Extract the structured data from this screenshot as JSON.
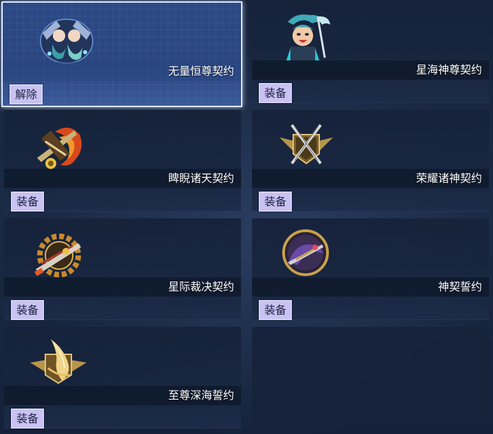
{
  "cards": [
    {
      "title": "无量恒尊契约",
      "button": "解除",
      "icon": "twin-heroes-emblem-icon"
    },
    {
      "title": "星海神尊契约",
      "button": "装备",
      "icon": "dragon-hero-portrait-icon"
    },
    {
      "title": "睥睨诸天契约",
      "button": "装备",
      "icon": "flaming-weapon-emblem-icon"
    },
    {
      "title": "荣耀诸神契约",
      "button": "装备",
      "icon": "crossed-swords-badge-icon"
    },
    {
      "title": "星际裁决契约",
      "button": "装备",
      "icon": "gear-cannon-emblem-icon"
    },
    {
      "title": "神契誓约",
      "button": "装备",
      "icon": "round-dragon-emblem-icon"
    },
    {
      "title": "至尊深海誓约",
      "button": "装备",
      "icon": "golden-shell-badge-icon"
    }
  ],
  "colors": {
    "button_bg": "#c9c2f3",
    "selected_border": "#dfe7ff",
    "selected_bg": "#2d4a86"
  }
}
